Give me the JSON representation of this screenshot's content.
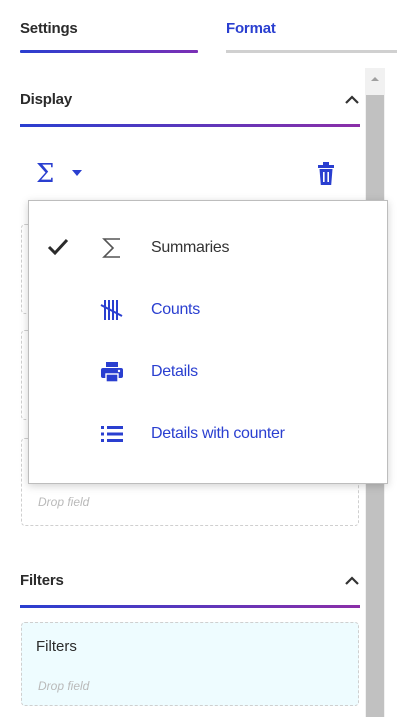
{
  "tabs": [
    {
      "label": "Settings",
      "active": true
    },
    {
      "label": "Format",
      "active": false
    }
  ],
  "sections": {
    "display": {
      "title": "Display",
      "expanded": true
    },
    "filters": {
      "title": "Filters",
      "expanded": true
    }
  },
  "display": {
    "aggregation_symbol": "Σ",
    "drop_zones": [
      {
        "hint": ""
      },
      {
        "hint": ""
      },
      {
        "hint": "Drop field"
      }
    ]
  },
  "filters_zone": {
    "label": "Filters",
    "hint": "Drop field"
  },
  "menu": {
    "items": [
      {
        "label": "Summaries",
        "icon": "sigma-icon",
        "selected": true
      },
      {
        "label": "Counts",
        "icon": "tally-icon",
        "selected": false
      },
      {
        "label": "Details",
        "icon": "printer-icon",
        "selected": false
      },
      {
        "label": "Details with counter",
        "icon": "list-icon",
        "selected": false
      }
    ]
  },
  "colors": {
    "accent": "#2a3fd0",
    "accent_secondary": "#7b2fb5",
    "text": "#333333",
    "hint": "#b9b9b9",
    "filters_bg": "#eefcff"
  }
}
